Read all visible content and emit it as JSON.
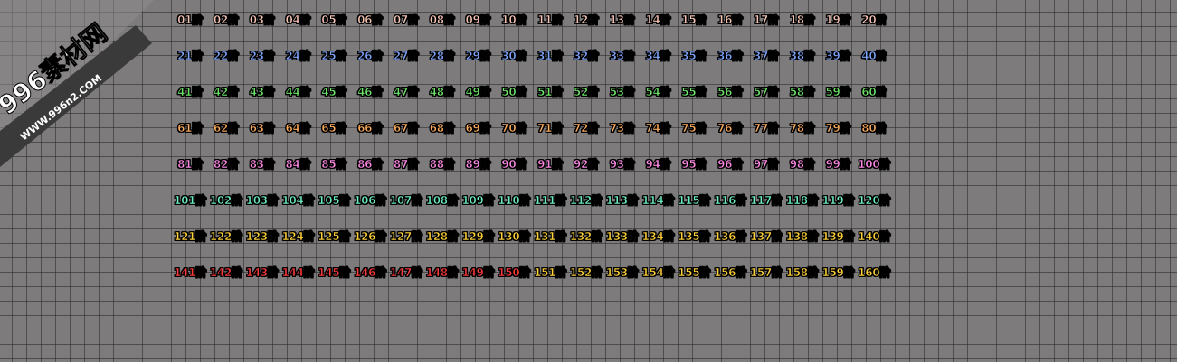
{
  "watermark": {
    "title": "996素材网",
    "url": "WWW.996n2.COM"
  },
  "colors": {
    "background": "#7d7b7c",
    "grid_line": "#5a5859",
    "watermark_band": "#3a3a3a"
  },
  "rows": [
    {
      "color": "#f6c4b4",
      "labels": [
        "01阶",
        "02阶",
        "03阶",
        "04阶",
        "05阶",
        "06阶",
        "07阶",
        "08阶",
        "09阶",
        "10阶",
        "11阶",
        "12阶",
        "13阶",
        "14阶",
        "15阶",
        "16阶",
        "17阶",
        "18阶",
        "19阶",
        "20阶"
      ]
    },
    {
      "color": "#7fa6ff",
      "labels": [
        "21阶",
        "22阶",
        "23阶",
        "24阶",
        "25阶",
        "26阶",
        "27阶",
        "28阶",
        "29阶",
        "30阶",
        "31阶",
        "32阶",
        "33阶",
        "34阶",
        "35阶",
        "36阶",
        "37阶",
        "38阶",
        "39阶",
        "40阶"
      ]
    },
    {
      "color": "#6fe36a",
      "labels": [
        "41阶",
        "42阶",
        "43阶",
        "44阶",
        "45阶",
        "46阶",
        "47阶",
        "48阶",
        "49阶",
        "50阶",
        "51阶",
        "52阶",
        "53阶",
        "54阶",
        "55阶",
        "56阶",
        "57阶",
        "58阶",
        "59阶",
        "60阶"
      ]
    },
    {
      "color": "#ffac5c",
      "labels": [
        "61阶",
        "62阶",
        "63阶",
        "64阶",
        "65阶",
        "66阶",
        "67阶",
        "68阶",
        "69阶",
        "70阶",
        "71阶",
        "72阶",
        "73阶",
        "74阶",
        "75阶",
        "76阶",
        "77阶",
        "78阶",
        "79阶",
        "80阶"
      ]
    },
    {
      "color": "#ff8ae6",
      "labels": [
        "81阶",
        "82阶",
        "83阶",
        "84阶",
        "85阶",
        "86阶",
        "87阶",
        "88阶",
        "89阶",
        "90阶",
        "91阶",
        "92阶",
        "93阶",
        "94阶",
        "95阶",
        "96阶",
        "97阶",
        "98阶",
        "99阶",
        "100阶"
      ]
    },
    {
      "color": "#6df0c6",
      "labels": [
        "101阶",
        "102阶",
        "103阶",
        "104阶",
        "105阶",
        "106阶",
        "107阶",
        "108阶",
        "109阶",
        "110阶",
        "111阶",
        "112阶",
        "113阶",
        "114阶",
        "115阶",
        "116阶",
        "117阶",
        "118阶",
        "119阶",
        "120阶"
      ]
    },
    {
      "color": "#ffd23a",
      "labels": [
        "121阶",
        "122阶",
        "123阶",
        "124阶",
        "125阶",
        "126阶",
        "127阶",
        "128阶",
        "129阶",
        "130阶",
        "131阶",
        "132阶",
        "133阶",
        "134阶",
        "135阶",
        "136阶",
        "137阶",
        "138阶",
        "139阶",
        "140阶"
      ]
    },
    {
      "color": "#ff3b3b",
      "labels": [
        "141阶",
        "142阶",
        "143阶",
        "144阶",
        "145阶",
        "146阶",
        "147阶",
        "148阶",
        "149阶",
        "150阶"
      ]
    },
    {
      "color": "#ffd23a",
      "labels": [
        "151阶",
        "152阶",
        "153阶",
        "154阶",
        "155阶",
        "156阶",
        "157阶",
        "158阶",
        "159阶",
        "160阶"
      ]
    }
  ]
}
